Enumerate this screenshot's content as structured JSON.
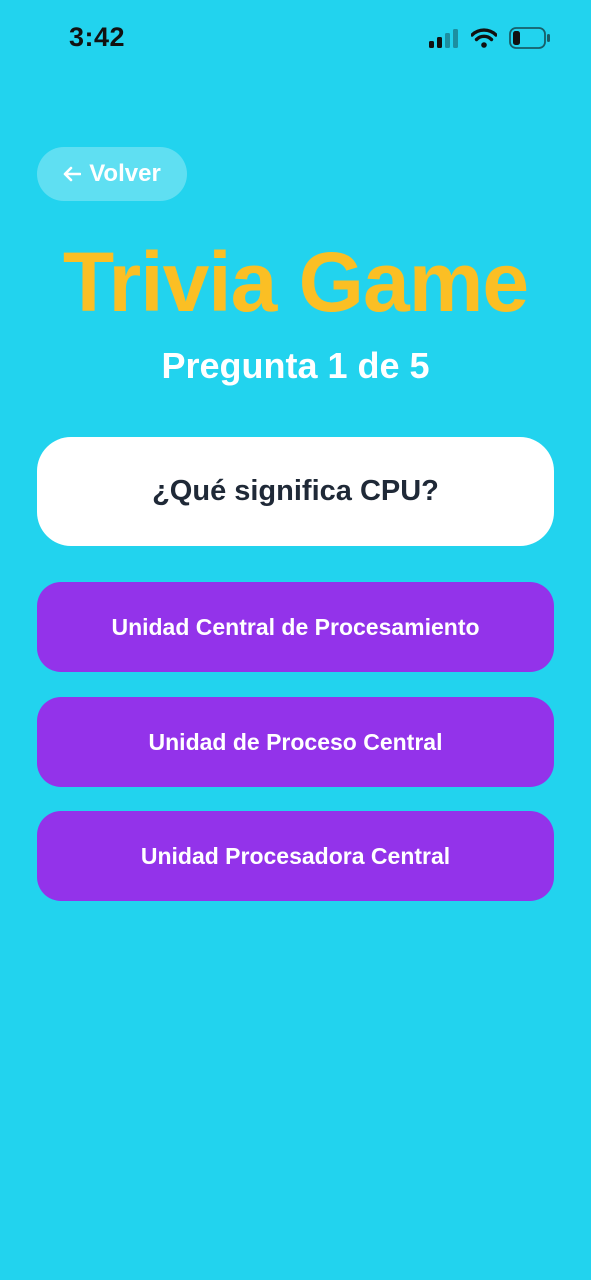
{
  "status_bar": {
    "time": "3:42",
    "icons": [
      "signal-icon",
      "wifi-icon",
      "battery-icon"
    ]
  },
  "nav": {
    "back_icon": "arrow-left-icon",
    "back_label": "Volver"
  },
  "header": {
    "title": "Trivia Game",
    "progress": "Pregunta 1 de 5"
  },
  "question": {
    "text": "¿Qué significa CPU?"
  },
  "answers": [
    {
      "label": "Unidad Central de Procesamiento"
    },
    {
      "label": "Unidad de Proceso Central"
    },
    {
      "label": "Unidad Procesadora Central"
    }
  ],
  "colors": {
    "background": "#22d3ee",
    "title": "#fbbf24",
    "answer_button": "#9333ea",
    "card": "#ffffff",
    "question_text": "#1f2937"
  }
}
